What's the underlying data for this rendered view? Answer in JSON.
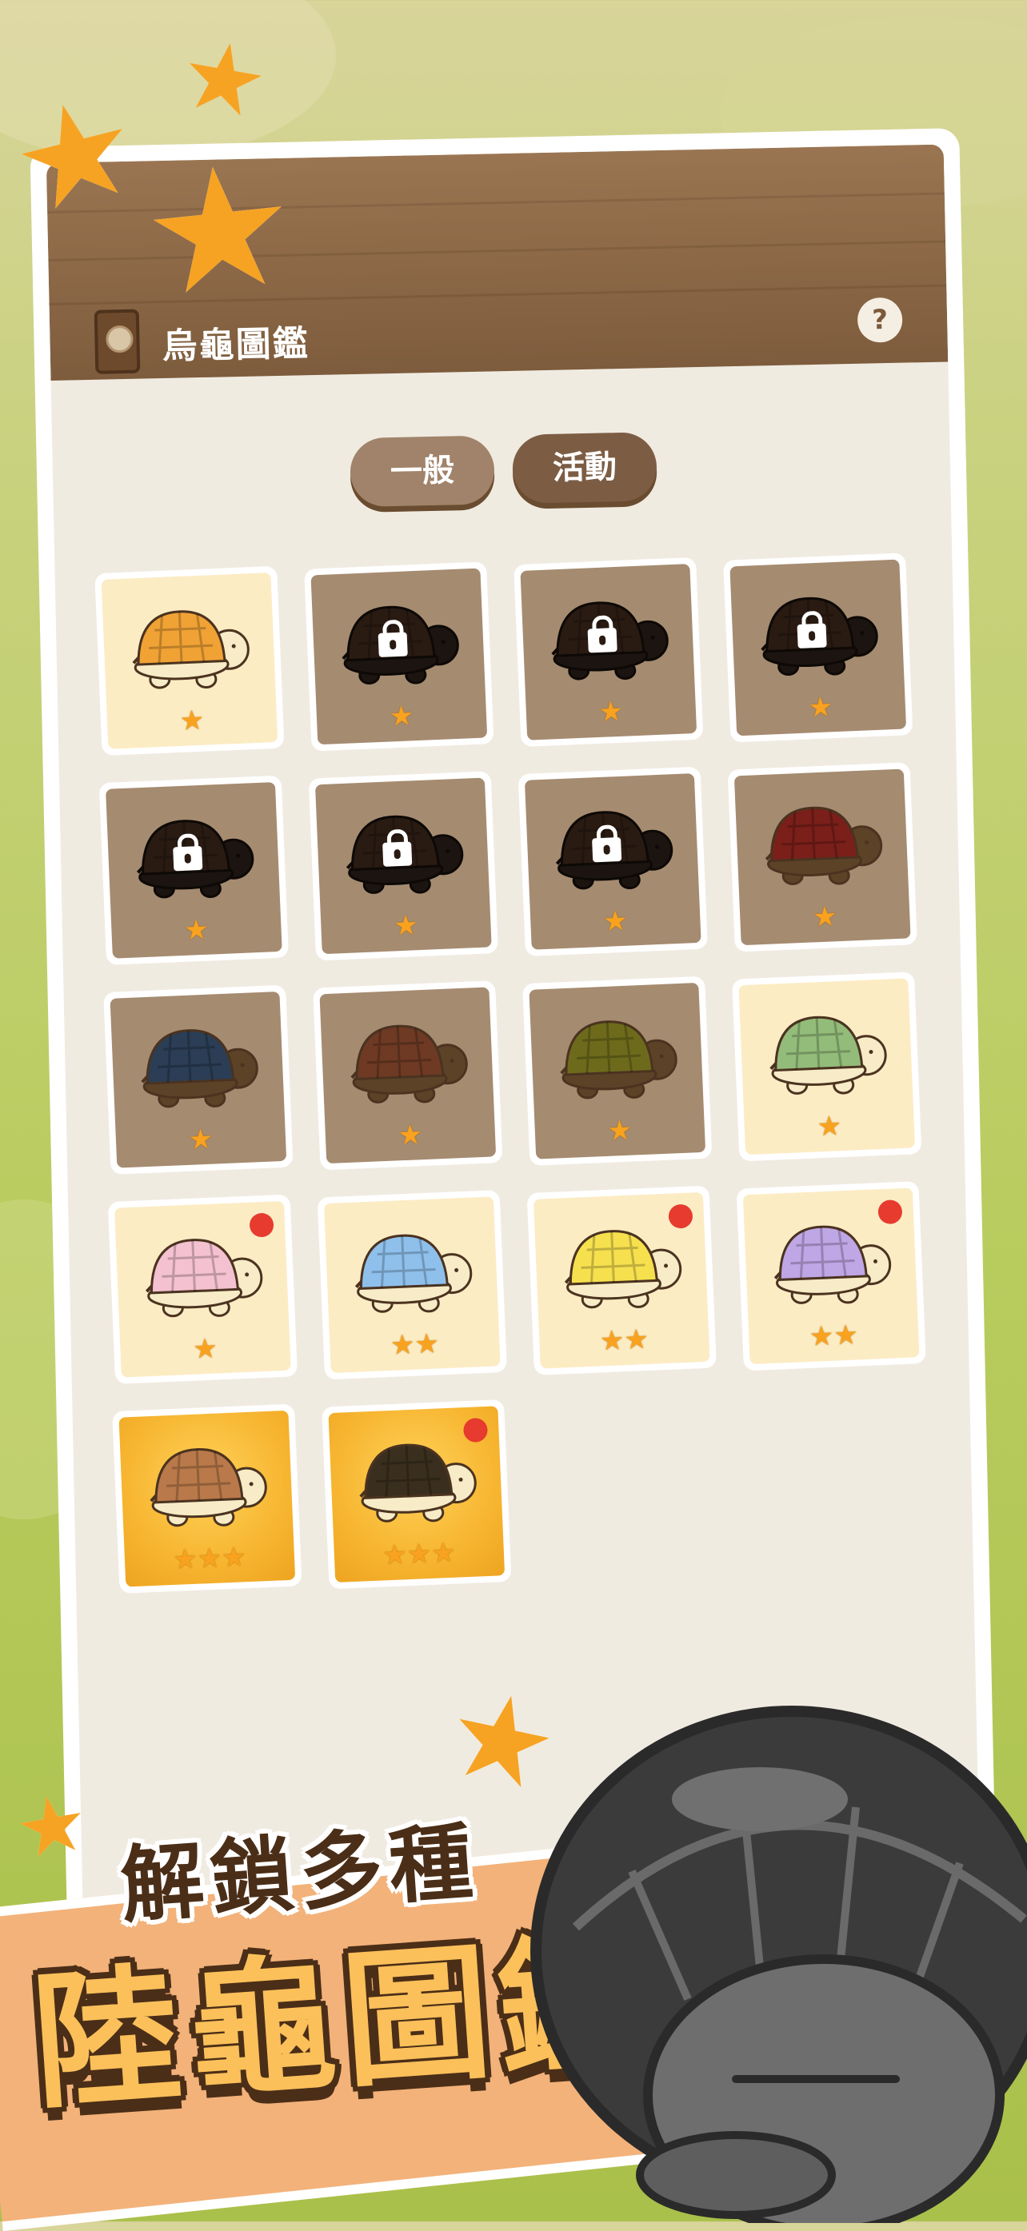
{
  "header": {
    "title": "烏龜圖鑑",
    "help_label": "?"
  },
  "tabs": [
    {
      "label": "一般",
      "active": false
    },
    {
      "label": "活動",
      "active": true
    }
  ],
  "colors": {
    "header": "#8c6846",
    "active_tab": "#7c5d44",
    "inactive_tab": "#a0836a",
    "star": "#f8a21f",
    "new_badge": "#e63b2e"
  },
  "turtles": [
    {
      "style": "cream",
      "shell": "#f0a235",
      "stars": "★",
      "locked": false,
      "new": false
    },
    {
      "style": "brown",
      "shell": "#2a1b12",
      "stars": "★",
      "locked": true,
      "new": false
    },
    {
      "style": "brown",
      "shell": "#2a1b12",
      "stars": "★",
      "locked": true,
      "new": false
    },
    {
      "style": "brown",
      "shell": "#2a1b12",
      "stars": "★",
      "locked": true,
      "new": false
    },
    {
      "style": "brown",
      "shell": "#2a1b12",
      "stars": "★",
      "locked": true,
      "new": false
    },
    {
      "style": "brown",
      "shell": "#2a1b12",
      "stars": "★",
      "locked": true,
      "new": false
    },
    {
      "style": "brown",
      "shell": "#2a1b12",
      "stars": "★",
      "locked": true,
      "new": false
    },
    {
      "style": "brown",
      "shell": "#7a1f1a",
      "stars": "★",
      "locked": false,
      "new": false
    },
    {
      "style": "brown",
      "shell": "#2b3e55",
      "stars": "★",
      "locked": false,
      "new": false
    },
    {
      "style": "brown",
      "shell": "#6e3a24",
      "stars": "★",
      "locked": false,
      "new": false
    },
    {
      "style": "brown",
      "shell": "#6d6b1b",
      "stars": "★",
      "locked": false,
      "new": false
    },
    {
      "style": "cream",
      "shell": "#93bc7a",
      "stars": "★",
      "locked": false,
      "new": false
    },
    {
      "style": "cream",
      "shell": "#f4c1d0",
      "stars": "★",
      "locked": false,
      "new": true
    },
    {
      "style": "cream",
      "shell": "#8fc0ec",
      "stars": "★★",
      "locked": false,
      "new": false
    },
    {
      "style": "cream",
      "shell": "#f6e04e",
      "stars": "★★",
      "locked": false,
      "new": true
    },
    {
      "style": "cream",
      "shell": "#bfa6e5",
      "stars": "★★",
      "locked": false,
      "new": true
    },
    {
      "style": "gold",
      "shell": "#b9794a",
      "stars": "★★★",
      "locked": false,
      "new": false
    },
    {
      "style": "gold",
      "shell": "#3a2f1e",
      "stars": "★★★",
      "locked": false,
      "new": true
    }
  ],
  "promo": {
    "subtitle": "解鎖多種",
    "headline": "陸龜圖鑑"
  }
}
